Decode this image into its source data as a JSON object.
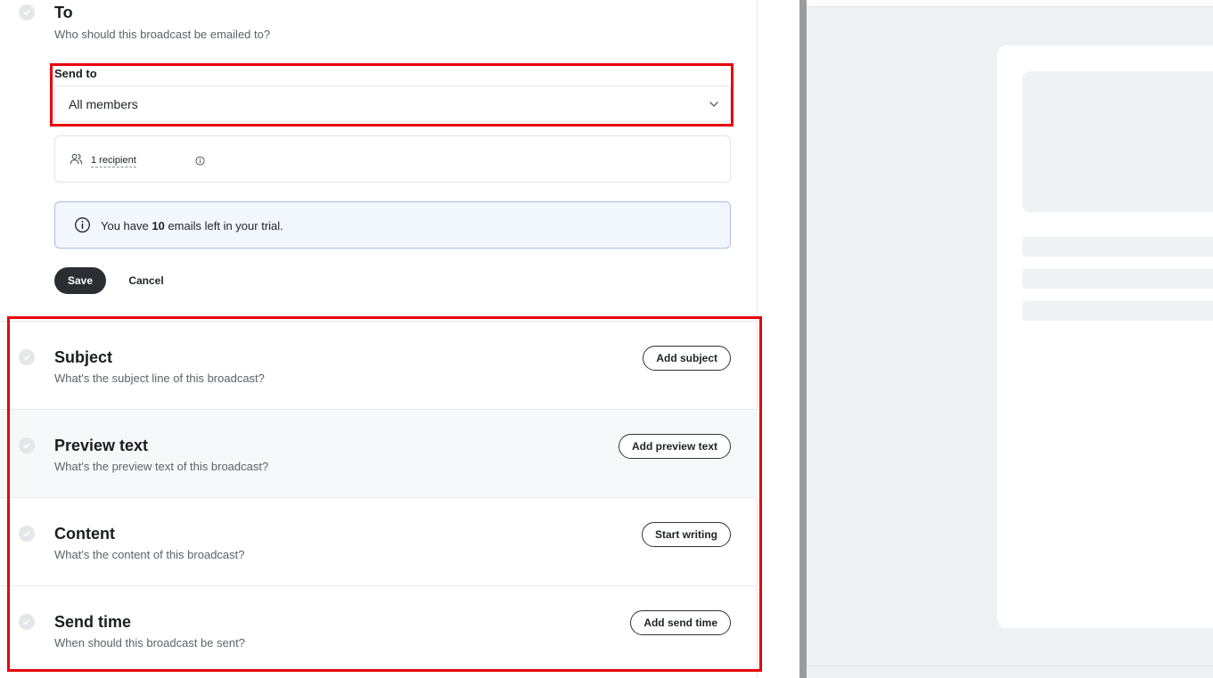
{
  "to_section": {
    "title": "To",
    "description": "Who should this broadcast be emailed to?",
    "send_to_label": "Send to",
    "send_to_value": "All members",
    "recipient_count": "1 recipient",
    "trial_prefix": "You have ",
    "trial_count": "10",
    "trial_suffix": " emails left in your trial.",
    "save_label": "Save",
    "cancel_label": "Cancel"
  },
  "sections": [
    {
      "title": "Subject",
      "description": "What's the subject line of this broadcast?",
      "button": "Add subject"
    },
    {
      "title": "Preview text",
      "description": "What's the preview text of this broadcast?",
      "button": "Add preview text"
    },
    {
      "title": "Content",
      "description": "What's the content of this broadcast?",
      "button": "Start writing"
    },
    {
      "title": "Send time",
      "description": "When should this broadcast be sent?",
      "button": "Add send time"
    }
  ],
  "colors": {
    "highlight": "#e8000b",
    "primary_button": "#2a2d31",
    "info_border": "#a9bde6",
    "info_bg": "#f2f6fd"
  }
}
